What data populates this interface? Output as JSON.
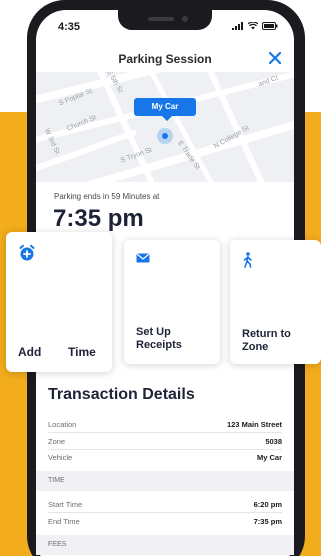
{
  "status_bar": {
    "time": "4:35"
  },
  "header": {
    "title": "Parking Session",
    "close_icon": "close-icon"
  },
  "map": {
    "streets": [
      "S Poplar St",
      "E 5th St",
      "W 3rd St",
      "S Tryon St",
      "E Trade St",
      "N College St",
      "Church St",
      "and Ct"
    ],
    "marker_label": "My Car"
  },
  "session": {
    "ends_label": "Parking ends in 59 Minutes at",
    "ends_time": "7:35 pm"
  },
  "actions": [
    {
      "label_a": "Add",
      "label_b": "Time",
      "icon": "alarm-add-icon"
    },
    {
      "label": "Set Up\nReceipts",
      "icon": "envelope-icon"
    },
    {
      "label": "Return to\nZone",
      "icon": "walking-person-icon"
    }
  ],
  "transaction": {
    "title": "Transaction Details",
    "rows": [
      {
        "label": "Location",
        "value": "123 Main Street"
      },
      {
        "label": "Zone",
        "value": "5038"
      },
      {
        "label": "Vehicle",
        "value": "My Car"
      }
    ],
    "time_section": "TIME",
    "time_rows": [
      {
        "label": "Start Time",
        "value": "6:20 pm"
      },
      {
        "label": "End Time",
        "value": "7:35 pm"
      }
    ],
    "fees_section": "FEES"
  },
  "colors": {
    "accent": "#1877e8",
    "background_band": "#f2ac1c",
    "heading": "#1f2337"
  }
}
